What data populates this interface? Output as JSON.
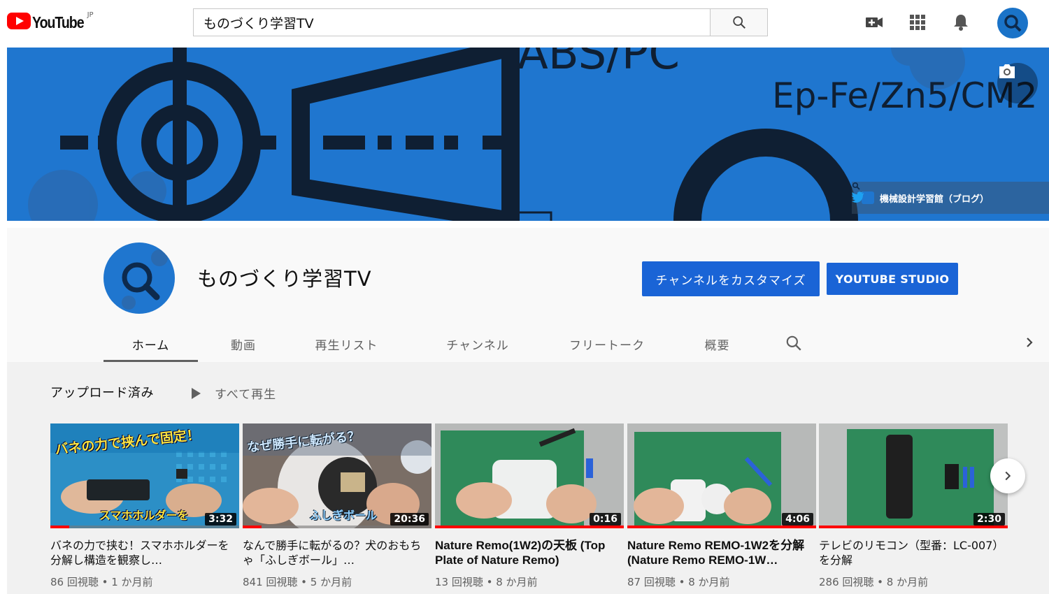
{
  "masthead": {
    "logo_text": "YouTube",
    "logo_country": "JP",
    "search_value": "ものづくり学習TV",
    "icons": [
      "video-camera-add-icon",
      "apps-grid-icon",
      "bell-icon",
      "search-icon"
    ]
  },
  "banner": {
    "text_top": "ABS/PC",
    "text_right": "Ep-Fe/Zn5/CM2",
    "link_label": "機械設計学習館（ブログ）"
  },
  "channel": {
    "title": "ものづくり学習TV",
    "customize_label": "チャンネルをカスタマイズ",
    "studio_label": "YOUTUBE STUDIO"
  },
  "tabs": [
    {
      "label": "ホーム",
      "active": true
    },
    {
      "label": "動画"
    },
    {
      "label": "再生リスト"
    },
    {
      "label": "チャンネル"
    },
    {
      "label": "フリートーク"
    },
    {
      "label": "概要"
    }
  ],
  "section": {
    "title": "アップロード済み",
    "play_all": "すべて再生"
  },
  "videos": [
    {
      "title": "バネの力で挟む！スマホホルダーを分解し構造を観察し…",
      "views": "86 回視聴",
      "age": "1 か月前",
      "duration": "3:32",
      "progress": 0.1,
      "overlay_top": "バネの力で挟んで固定！",
      "overlay_bottom": "スマホホルダーを"
    },
    {
      "title": "なんで勝手に転がるの？犬のおもちゃ「ふしぎボール」…",
      "views": "841 回視聴",
      "age": "5 か月前",
      "duration": "20:36",
      "progress": 0.1,
      "overlay_top": "なぜ勝手に転がる？",
      "overlay_bottom": "ふしぎボール"
    },
    {
      "title": "Nature Remo(1W2)の天板 (Top Plate of Nature Remo)",
      "views": "13 回視聴",
      "age": "8 か月前",
      "duration": "0:16",
      "progress": 1.0
    },
    {
      "title": "Nature Remo REMO-1W2を分解 (Nature Remo REMO-1W…",
      "views": "87 回視聴",
      "age": "8 か月前",
      "duration": "4:06",
      "progress": 1.0
    },
    {
      "title": "テレビのリモコン（型番：LC-007）を分解",
      "views": "286 回視聴",
      "age": "8 か月前",
      "duration": "2:30",
      "progress": 1.0
    }
  ],
  "meta_separator": " • ",
  "colors": {
    "brand_red": "#ff0000",
    "button_blue": "#1a64d6",
    "banner_blue": "#1f76cf",
    "mat_green": "#2f8a5a"
  }
}
